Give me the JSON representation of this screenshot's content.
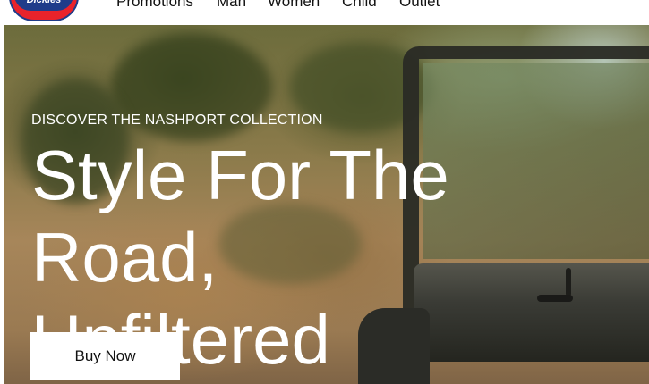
{
  "nav": {
    "logo_text": "Dickies",
    "items": [
      {
        "label": "Promotions"
      },
      {
        "label": "Man"
      },
      {
        "label": "Women"
      },
      {
        "label": "Child"
      },
      {
        "label": "Outlet"
      }
    ]
  },
  "hero": {
    "eyebrow": "DISCOVER THE NASHPORT COLLECTION",
    "headline_line1": "Style For The Road,",
    "headline_line2": "Unfiltered",
    "cta_label": "Buy Now"
  },
  "colors": {
    "logo_red": "#e9232b",
    "logo_blue": "#1f3c8a",
    "hero_text": "#ffffff",
    "cta_bg": "#ffffff"
  }
}
